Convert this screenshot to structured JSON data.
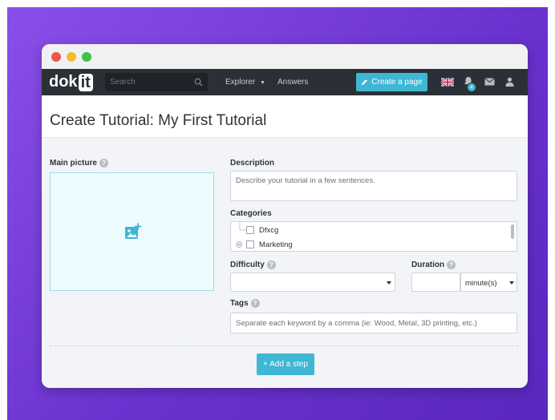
{
  "navbar": {
    "logo_text": "dok",
    "logo_highlight": "it",
    "search_placeholder": "Search",
    "explorer_label": "Explorer",
    "answers_label": "Answers",
    "create_page_label": "Create a page",
    "notification_count": "4"
  },
  "page": {
    "title": "Create Tutorial: My First Tutorial"
  },
  "form": {
    "main_picture_label": "Main picture",
    "description_label": "Description",
    "description_placeholder": "Describe your tutorial in a few sentences.",
    "categories_label": "Categories",
    "categories": [
      {
        "label": "Dfxcg"
      },
      {
        "label": "Marketing"
      }
    ],
    "difficulty_label": "Difficulty",
    "difficulty_value": "",
    "duration_label": "Duration",
    "duration_value": "",
    "duration_unit": "minute(s)",
    "tags_label": "Tags",
    "tags_placeholder": "Separate each keyword by a comma (ie: Wood, Metal, 3D printing, etc.)",
    "add_step_label": "+ Add a step",
    "help_glyph": "?"
  },
  "colors": {
    "accent": "#3fb6d3",
    "navbar": "#2b3036",
    "background_gradient_start": "#8a4fe8",
    "background_gradient_end": "#5a27bf"
  }
}
